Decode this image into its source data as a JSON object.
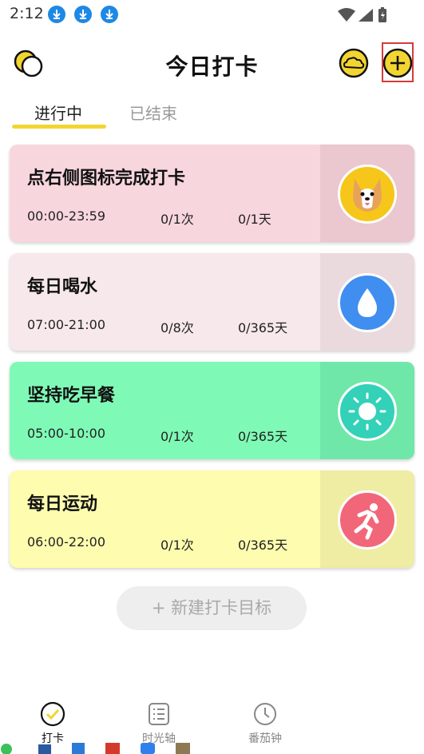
{
  "status_bar": {
    "time": "2:12",
    "download_icons": [
      "download-icon",
      "download-icon",
      "download-icon"
    ],
    "right_icons": [
      "wifi-icon",
      "signal-icon",
      "battery-icon"
    ]
  },
  "header": {
    "title": "今日打卡",
    "left_icon": "theme-moon-icon",
    "right_icons": [
      "cloud-icon",
      "add-icon"
    ]
  },
  "tabs": [
    {
      "label": "进行中",
      "active": true
    },
    {
      "label": "已结束",
      "active": false
    }
  ],
  "cards": [
    {
      "title": "点右侧图标完成打卡",
      "time": "00:00-23:59",
      "count": "0/1次",
      "days": "0/1天",
      "icon": "corgi-dog-icon",
      "bg": "#f8d6de",
      "side": "#ebc7cf",
      "icon_bg": "#f6c71a"
    },
    {
      "title": "每日喝水",
      "time": "07:00-21:00",
      "count": "0/8次",
      "days": "0/365天",
      "icon": "water-drop-icon",
      "bg": "#f7e8ec",
      "side": "#eadade",
      "icon_bg": "#3f8ef0"
    },
    {
      "title": "坚持吃早餐",
      "time": "05:00-10:00",
      "count": "0/1次",
      "days": "0/365天",
      "icon": "sun-icon",
      "bg": "#7ffab6",
      "side": "#6ee7a8",
      "icon_bg": "#33d1b8"
    },
    {
      "title": "每日运动",
      "time": "06:00-22:00",
      "count": "0/1次",
      "days": "0/365天",
      "icon": "running-icon",
      "bg": "#fefdaf",
      "side": "#efeca4",
      "icon_bg": "#f26679"
    }
  ],
  "new_goal_button": "+  新建打卡目标",
  "bottom_nav": [
    {
      "label": "打卡",
      "icon": "check-circle-icon",
      "active": true
    },
    {
      "label": "时光轴",
      "icon": "list-icon",
      "active": false
    },
    {
      "label": "番茄钟",
      "icon": "clock-icon",
      "active": false
    }
  ],
  "colors": {
    "accent_yellow": "#f3d531",
    "highlight_red": "#d63a3a",
    "inactive_text": "#9a9a9a"
  }
}
